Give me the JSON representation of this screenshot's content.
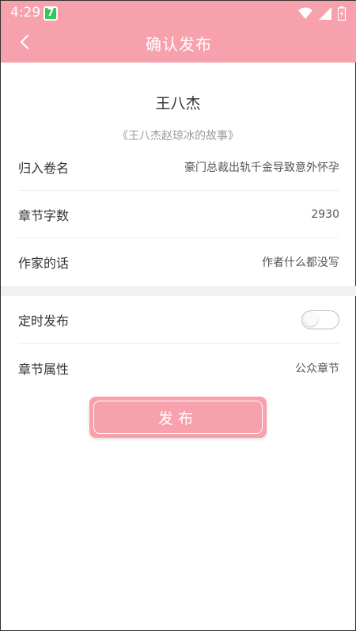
{
  "status": {
    "time": "4:29",
    "app_badge": "7"
  },
  "header": {
    "title": "确认发布"
  },
  "book": {
    "author": "王八杰",
    "title": "《王八杰赵琼冰的故事》"
  },
  "rows": [
    {
      "label": "归入卷名",
      "value": "豪门总裁出轨千金导致意外怀孕"
    },
    {
      "label": "章节字数",
      "value": "2930"
    },
    {
      "label": "作家的话",
      "value": "作者什么都没写"
    }
  ],
  "schedule": {
    "label": "定时发布",
    "enabled": false
  },
  "attribute": {
    "label": "章节属性",
    "value": "公众章节"
  },
  "actions": {
    "publish_label": "发布"
  },
  "colors": {
    "accent": "#f7a1ad"
  }
}
